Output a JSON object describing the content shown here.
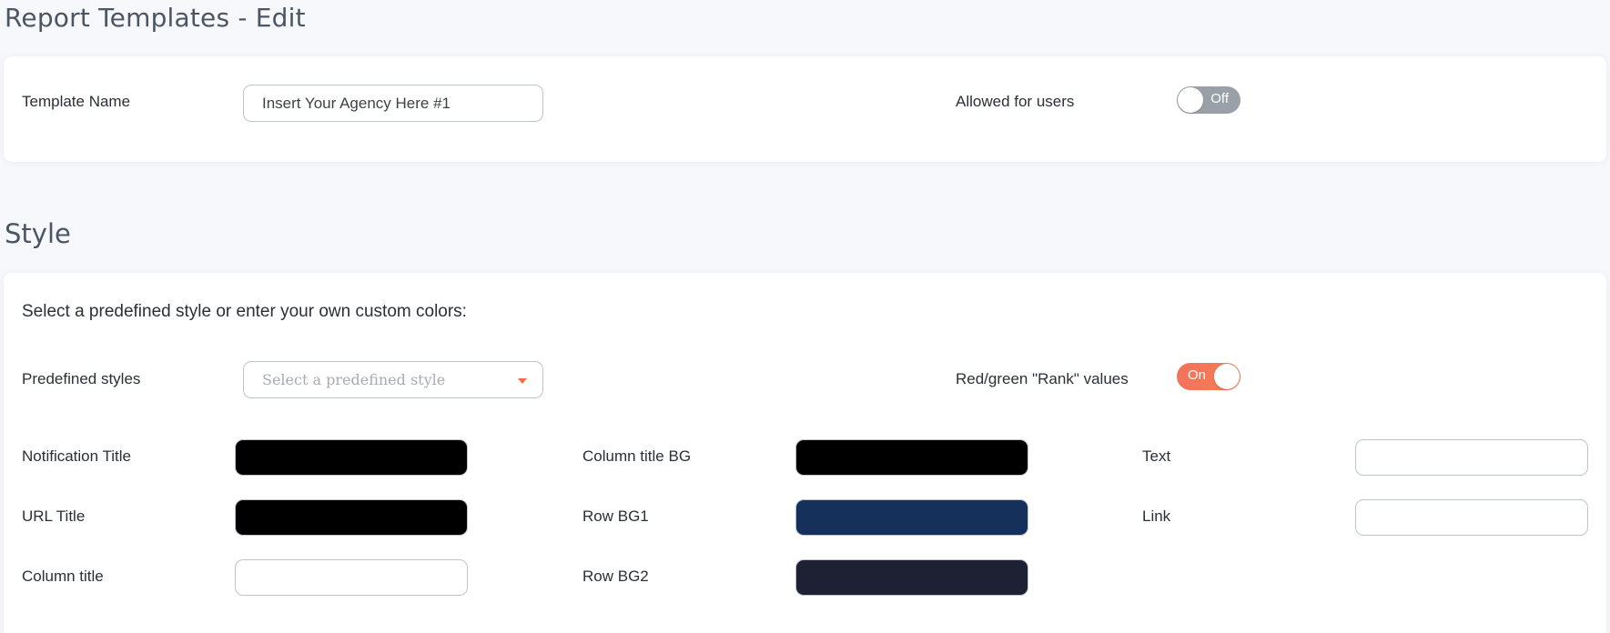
{
  "page": {
    "title": "Report Templates - Edit"
  },
  "general": {
    "template_name_label": "Template Name",
    "template_name_value": "Insert Your Agency Here #1",
    "allowed_for_users_label": "Allowed for users",
    "allowed_for_users_state": "Off"
  },
  "style": {
    "title": "Style",
    "intro": "Select a predefined style or enter your own custom colors:",
    "predefined_label": "Predefined styles",
    "predefined_placeholder": "Select a predefined style",
    "rank_label": "Red/green \"Rank\" values",
    "rank_state": "On",
    "colors": {
      "notification_title": {
        "label": "Notification Title",
        "value": "#000000"
      },
      "url_title": {
        "label": "URL Title",
        "value": "#000000"
      },
      "column_title": {
        "label": "Column title",
        "value": "#ffffff"
      },
      "column_title_bg": {
        "label": "Column title BG",
        "value": "#000000"
      },
      "row_bg1": {
        "label": "Row BG1",
        "value": "#14305b"
      },
      "row_bg2": {
        "label": "Row BG2",
        "value": "#1e2033"
      },
      "text": {
        "label": "Text",
        "value": "#ffffff"
      },
      "link": {
        "label": "Link",
        "value": "#ffffff"
      }
    }
  },
  "theme": {
    "accent": "#f26d47",
    "toggle_off": "#9aa0a8"
  }
}
